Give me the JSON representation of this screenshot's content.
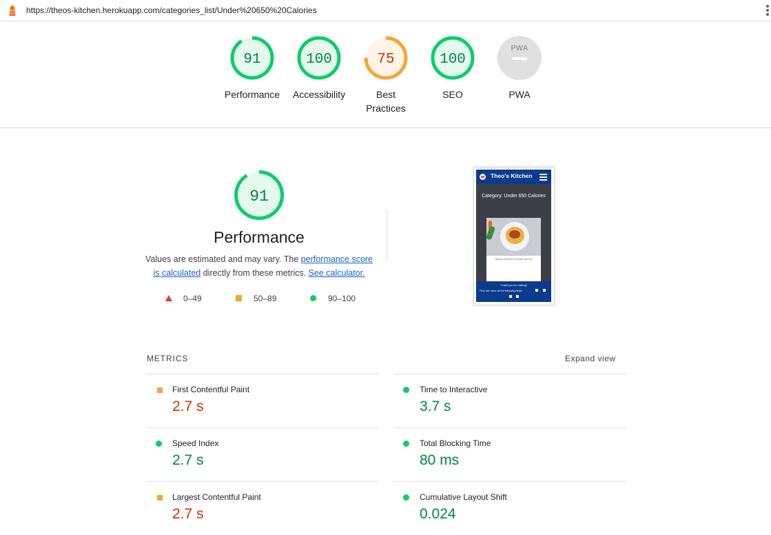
{
  "browser": {
    "url": "https://theos-kitchen.herokuapp.com/categories_list/Under%20650%20Calories",
    "icons": [
      "lighthouse-icon",
      "more-vert-icon"
    ]
  },
  "gauges": [
    {
      "label": "Performance",
      "score": "91",
      "color": "#0cce6b",
      "text_color": "#018642",
      "fill": "#e5f9ee",
      "fraction": 0.91
    },
    {
      "label": "Accessibility",
      "score": "100",
      "color": "#0cce6b",
      "text_color": "#018642",
      "fill": "#e5f9ee",
      "fraction": 1.0
    },
    {
      "label": "Best\nPractices",
      "label_line1": "Best",
      "label_line2": "Practices",
      "score": "75",
      "color": "#f4a633",
      "text_color": "#c33300",
      "fill": "#fff4e8",
      "fraction": 0.75
    },
    {
      "label": "SEO",
      "score": "100",
      "color": "#0cce6b",
      "text_color": "#018642",
      "fill": "#e5f9ee",
      "fraction": 1.0
    },
    {
      "label": "PWA",
      "score": "PWA",
      "color": "#e0e0e0",
      "text_color": "#9e9e9e",
      "fill": "#e0e0e0",
      "fraction": 0
    }
  ],
  "performance": {
    "score": "91",
    "fraction": 0.91,
    "title": "Performance",
    "desc_prefix": "Values are estimated and may vary. The ",
    "desc_link1": "performance score is calculated",
    "desc_middle": " directly from these metrics. ",
    "desc_link2": "See calculator."
  },
  "legend": [
    {
      "shape": "triangle",
      "range": "0–49",
      "color": "#e53935"
    },
    {
      "shape": "square",
      "range": "50–89",
      "color": "#f4a633"
    },
    {
      "shape": "circle",
      "range": "90–100",
      "color": "#0cce6b"
    }
  ],
  "screenshot": {
    "site_title": "Theo's Kitchen",
    "category": "Category: Under 650 Calories",
    "card_caption": "Glazed Chicken & Pepper Stir Fry",
    "footer_line1": "Thank you for visiting!",
    "footer_line2": "Find out more at the following links:"
  },
  "metrics": {
    "title": "METRICS",
    "expand_label": "Expand view",
    "items": [
      {
        "name": "First Contentful Paint",
        "value": "2.7 s",
        "status": "average"
      },
      {
        "name": "Time to Interactive",
        "value": "3.7 s",
        "status": "pass"
      },
      {
        "name": "Speed Index",
        "value": "2.7 s",
        "status": "pass"
      },
      {
        "name": "Total Blocking Time",
        "value": "80 ms",
        "status": "pass"
      },
      {
        "name": "Largest Contentful Paint",
        "value": "2.7 s",
        "status": "average"
      },
      {
        "name": "Cumulative Layout Shift",
        "value": "0.024",
        "status": "pass"
      }
    ]
  }
}
